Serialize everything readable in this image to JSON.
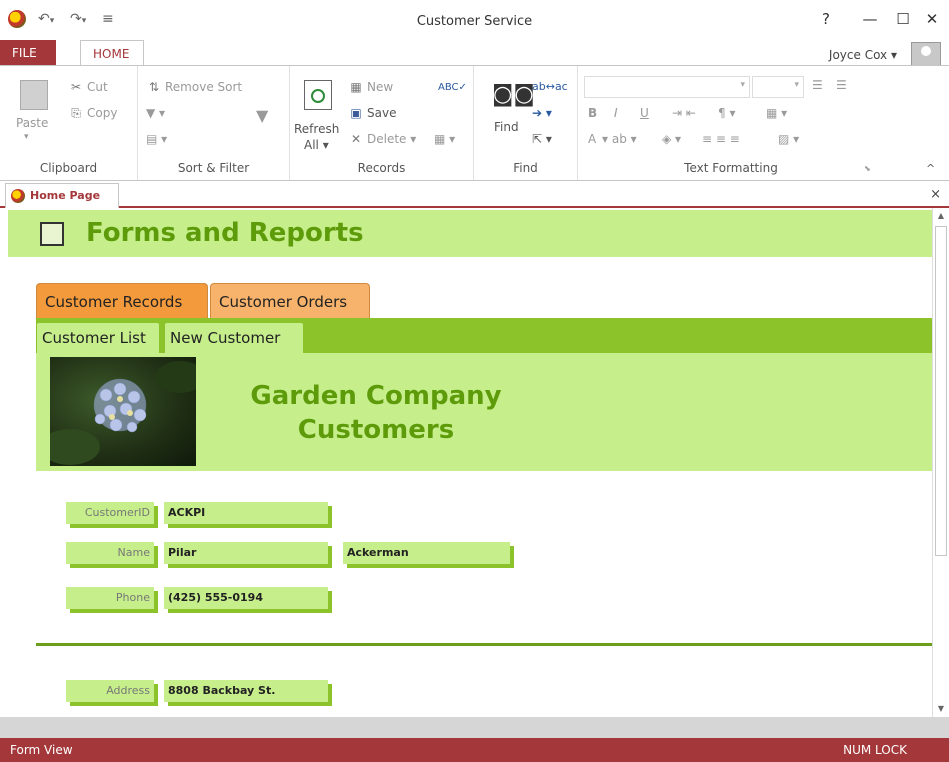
{
  "window": {
    "title": "Customer Service",
    "help": "?",
    "minimize": "—",
    "maximize": "☐",
    "close": "✕"
  },
  "ribbon_tabs": {
    "file": "FILE",
    "home": "HOME"
  },
  "user": {
    "name": "Joyce Cox ▾"
  },
  "ribbon": {
    "clipboard": {
      "label": "Clipboard",
      "paste": "Paste",
      "cut": "Cut",
      "copy": "Copy"
    },
    "sort_filter": {
      "label": "Sort & Filter",
      "remove_sort": "Remove Sort"
    },
    "records": {
      "label": "Records",
      "refresh": "Refresh",
      "refresh_all": "All ▾",
      "new": "New",
      "save": "Save",
      "delete": "Delete"
    },
    "find": {
      "label": "Find",
      "find": "Find"
    },
    "text_formatting": {
      "label": "Text Formatting",
      "bold": "B",
      "italic": "I",
      "underline": "U",
      "font_color": "A"
    }
  },
  "document_tab": {
    "label": "Home Page",
    "close": "×"
  },
  "form": {
    "header_title": "Forms and Reports",
    "tabs": [
      "Customer Records",
      "Customer Orders"
    ],
    "subtabs": [
      "Customer List",
      "New Customer"
    ],
    "company_title": "Garden Company Customers",
    "fields": {
      "customer_id": {
        "label": "CustomerID",
        "value": "ACKPI"
      },
      "name": {
        "label": "Name",
        "first": "Pilar",
        "last": "Ackerman"
      },
      "phone": {
        "label": "Phone",
        "value": "(425) 555-0194"
      },
      "address": {
        "label": "Address",
        "value": "8808 Backbay St."
      }
    }
  },
  "status": {
    "left": "Form View",
    "right": "NUM LOCK"
  },
  "colors": {
    "access_red": "#a4373a",
    "green_light": "#c6ef8c",
    "green_dark": "#8cc22a",
    "title_green": "#5e9b0a",
    "tab_orange": "#f29a3c"
  }
}
